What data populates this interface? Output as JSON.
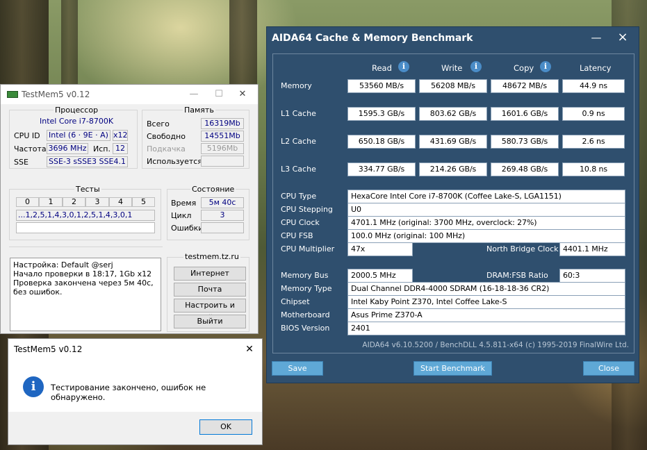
{
  "aida": {
    "title": "AIDA64 Cache & Memory Benchmark",
    "close_glyph": "×",
    "minimize_glyph": "—",
    "headers": {
      "read": "Read",
      "write": "Write",
      "copy": "Copy",
      "latency": "Latency"
    },
    "info_glyph": "i",
    "bench": [
      {
        "label": "Memory",
        "read": "53560 MB/s",
        "write": "56208 MB/s",
        "copy": "48672 MB/s",
        "latency": "44.9 ns"
      },
      {
        "label": "L1 Cache",
        "read": "1595.3 GB/s",
        "write": "803.62 GB/s",
        "copy": "1601.6 GB/s",
        "latency": "0.9 ns"
      },
      {
        "label": "L2 Cache",
        "read": "650.18 GB/s",
        "write": "431.69 GB/s",
        "copy": "580.73 GB/s",
        "latency": "2.6 ns"
      },
      {
        "label": "L3 Cache",
        "read": "334.77 GB/s",
        "write": "214.26 GB/s",
        "copy": "269.48 GB/s",
        "latency": "10.8 ns"
      }
    ],
    "info": {
      "cpu_type_label": "CPU Type",
      "cpu_type": "HexaCore Intel Core i7-8700K  (Coffee Lake-S, LGA1151)",
      "cpu_stepping_label": "CPU Stepping",
      "cpu_stepping": "U0",
      "cpu_clock_label": "CPU Clock",
      "cpu_clock": "4701.1 MHz  (original: 3700 MHz, overclock: 27%)",
      "cpu_fsb_label": "CPU FSB",
      "cpu_fsb": "100.0 MHz  (original: 100 MHz)",
      "cpu_multiplier_label": "CPU Multiplier",
      "cpu_multiplier": "47x",
      "nb_clock_label": "North Bridge Clock",
      "nb_clock": "4401.1 MHz",
      "memory_bus_label": "Memory Bus",
      "memory_bus": "2000.5 MHz",
      "dram_fsb_label": "DRAM:FSB Ratio",
      "dram_fsb": "60:3",
      "memory_type_label": "Memory Type",
      "memory_type": "Dual Channel DDR4-4000 SDRAM  (16-18-18-36 CR2)",
      "chipset_label": "Chipset",
      "chipset": "Intel Kaby Point Z370, Intel Coffee Lake-S",
      "motherboard_label": "Motherboard",
      "motherboard": "Asus Prime Z370-A",
      "bios_label": "BIOS Version",
      "bios": "2401"
    },
    "footer": "AIDA64 v6.10.5200 / BenchDLL 4.5.811-x64  (c) 1995-2019 FinalWire Ltd.",
    "buttons": {
      "save": "Save",
      "start": "Start Benchmark",
      "close": "Close"
    },
    "colors": {
      "window_bg": "#2f4f6e",
      "button_bg": "#5fa8d6"
    }
  },
  "testmem": {
    "title": "TestMem5 v0.12",
    "cpu_group": "Процессор",
    "cpu_name": "Intel Core i7-8700K",
    "cpuid_label": "CPU ID",
    "cpuid_value": "Intel  (6 · 9E · A)",
    "cpuid_threads": "x12",
    "freq_label": "Частота",
    "freq_value": "3696 MHz",
    "used_label": "Исп.",
    "used_value": "12",
    "sse_label": "SSE",
    "sse_value": "SSE-3 sSSE3 SSE4.1",
    "mem_group": "Память",
    "total_label": "Всего",
    "total_value": "16319Mb",
    "free_label": "Свободно",
    "free_value": "14551Mb",
    "swap_label": "Подкачка",
    "swap_value": "5196Mb",
    "inuse_label": "Используется",
    "inuse_value": "",
    "tests_group": "Тесты",
    "test_cells": [
      "0",
      "1",
      "2",
      "3",
      "4",
      "5"
    ],
    "test_sequence": "...1,2,5,1,4,3,0,1,2,5,1,4,3,0,1",
    "state_group": "Состояние",
    "time_label": "Время",
    "time_value": "5м 40с",
    "cycle_label": "Цикл",
    "cycle_value": "3",
    "errors_label": "Ошибки",
    "errors_value": "",
    "site_group": "testmem.tz.ru",
    "log_lines": [
      "Настройка: Default @serj",
      "Начало проверки в 18:17, 1Gb x12",
      "Проверка закончена через 5м 40с,",
      "без ошибок."
    ],
    "btn_internet": "Интернет",
    "btn_mail": "Почта",
    "btn_configure": "Настроить и выйти",
    "btn_exit": "Выйти",
    "min_glyph": "—",
    "max_glyph": "☐",
    "close_glyph": "✕"
  },
  "dialog": {
    "title": "TestMem5 v0.12",
    "message": "Тестирование закончено, ошибок не обнаружено.",
    "ok": "OK",
    "close_glyph": "✕",
    "info_glyph": "i"
  }
}
